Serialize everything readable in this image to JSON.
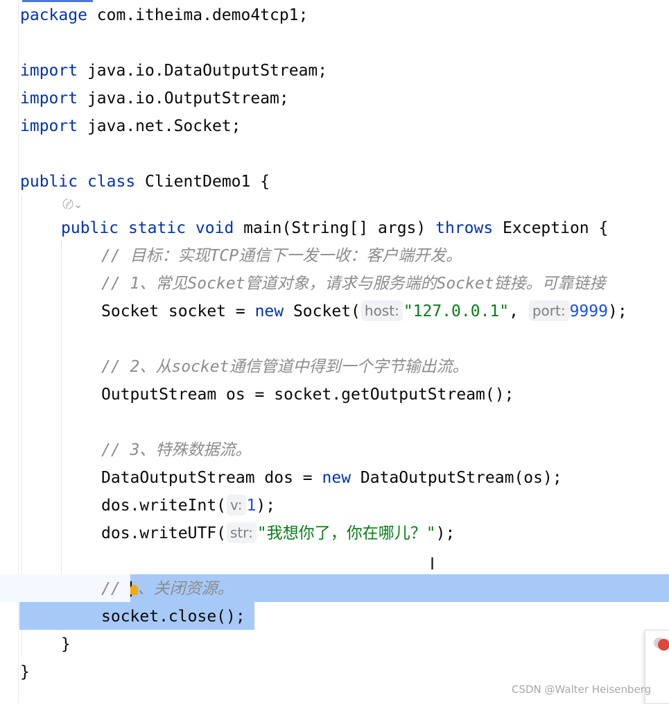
{
  "code": {
    "l1": {
      "kw": "package",
      "rest": " com.itheima.demo4tcp1;"
    },
    "l3": {
      "kw": "import",
      "rest": " java.io.DataOutputStream;"
    },
    "l4": {
      "kw": "import",
      "rest": " java.io.OutputStream;"
    },
    "l5": {
      "kw": "import",
      "rest": " java.net.Socket;"
    },
    "l7": {
      "kw1": "public",
      "kw2": "class",
      "rest": " ClientDemo1 {"
    },
    "l8": {
      "ai_icon": "〄⌄"
    },
    "l9": {
      "kw1": "public",
      "kw2": "static",
      "kw3": "void",
      "name": " main(String[] args) ",
      "kw4": "throws",
      "rest": " Exception {"
    },
    "l10": {
      "comment": "// 目标：实现TCP通信下一发一收：客户端开发。"
    },
    "l11": {
      "comment": "// 1、常见Socket管道对象，请求与服务端的Socket链接。可靠链接"
    },
    "l12": {
      "a": "Socket socket = ",
      "kw": "new",
      "b": " Socket(",
      "hint1": "host:",
      "str": "\"127.0.0.1\"",
      "c": ", ",
      "hint2": "port:",
      "num": "9999",
      "d": ");"
    },
    "l14": {
      "comment": "// 2、从socket通信管道中得到一个字节输出流。"
    },
    "l15": {
      "text": "OutputStream os = socket.getOutputStream();"
    },
    "l17": {
      "comment": "// 3、特殊数据流。"
    },
    "l18": {
      "a": "DataOutputStream dos = ",
      "kw": "new",
      "b": " DataOutputStream(os);"
    },
    "l19": {
      "a": "dos.writeInt(",
      "hint": "v:",
      "num": "1",
      "b": ");"
    },
    "l20": {
      "a": "dos.writeUTF(",
      "hint": "str:",
      "str": "\"我想你了，你在哪儿？\"",
      "b": ");"
    },
    "l22": {
      "comment_a": "// ",
      "comment_b": "、关闭资源。"
    },
    "l23": {
      "text": "socket.close();"
    },
    "l24": {
      "text": "}"
    },
    "l25": {
      "text": "}"
    }
  },
  "watermark": "CSDN @Walter Heisenberg",
  "colors": {
    "keyword": "#0033b3",
    "string": "#067d17",
    "number": "#1750eb",
    "comment": "#8c8c8c",
    "selection": "#a6c9f7",
    "bulb": "#f7a80b"
  }
}
